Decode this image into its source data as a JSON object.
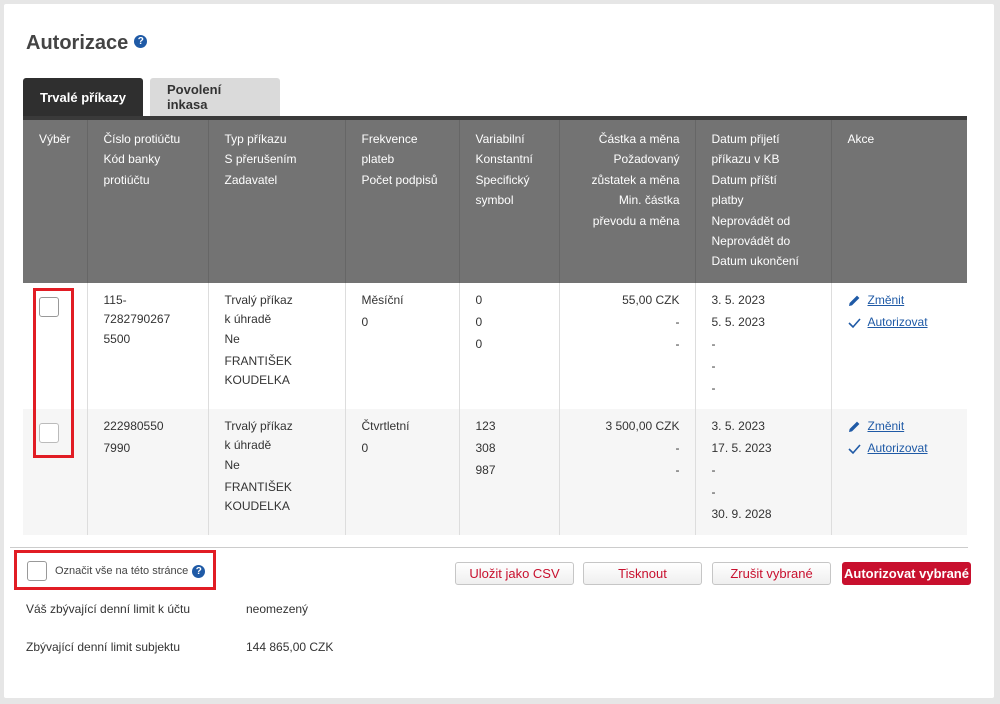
{
  "page": {
    "title": "Autorizace"
  },
  "tabs": [
    {
      "label": "Trvalé příkazy",
      "active": true
    },
    {
      "label": "Povolení inkasa",
      "active": false
    }
  ],
  "table": {
    "headers": [
      [
        "Výběr"
      ],
      [
        "Číslo protiúčtu",
        "Kód banky",
        "protiúčtu"
      ],
      [
        "Typ příkazu",
        "S přerušením",
        "Zadavatel"
      ],
      [
        "Frekvence",
        "plateb",
        "Počet podpisů"
      ],
      [
        "Variabilní",
        "Konstantní",
        "Specifický",
        "symbol"
      ],
      [
        "Částka a měna",
        "Požadovaný",
        "zůstatek a měna",
        "Min. částka",
        "převodu a měna"
      ],
      [
        "Datum přijetí",
        "příkazu v KB",
        "Datum příští",
        "platby",
        "Neprovádět od",
        "Neprovádět do",
        "Datum ukončení"
      ],
      [
        "Akce"
      ]
    ],
    "rows": [
      {
        "account": [
          "115-",
          "7282790267"
        ],
        "bank": "5500",
        "type": [
          "Trvalý příkaz",
          "k úhradě"
        ],
        "interrupt": "Ne",
        "creator": [
          "FRANTIŠEK",
          "KOUDELKA"
        ],
        "freq": "Měsíční",
        "signatures": "0",
        "symbols": [
          "0",
          "0",
          "0"
        ],
        "amounts": [
          "55,00 CZK",
          "-",
          "-"
        ],
        "dates": [
          "3. 5. 2023",
          "5. 5. 2023",
          "-",
          "-",
          "-"
        ],
        "actions": [
          "Změnit",
          "Autorizovat"
        ]
      },
      {
        "account": [
          "222980550"
        ],
        "bank": "7990",
        "type": [
          "Trvalý příkaz",
          "k úhradě"
        ],
        "interrupt": "Ne",
        "creator": [
          "FRANTIŠEK",
          "KOUDELKA"
        ],
        "freq": "Čtvrtletní",
        "signatures": "0",
        "symbols": [
          "123",
          "308",
          "987"
        ],
        "amounts": [
          "3 500,00 CZK",
          "-",
          "-"
        ],
        "dates": [
          "3. 5. 2023",
          "17. 5. 2023",
          "-",
          "-",
          "30. 9. 2028"
        ],
        "actions": [
          "Změnit",
          "Autorizovat"
        ]
      }
    ]
  },
  "select_all": {
    "label": "Označit vše na této stránce"
  },
  "buttons": {
    "csv": "Uložit jako CSV",
    "print": "Tisknout",
    "cancel": "Zrušit vybrané",
    "authorize": "Autorizovat vybrané"
  },
  "limits": [
    {
      "label": "Váš zbývající denní limit k účtu",
      "value": "neomezený"
    },
    {
      "label": "Zbývající denní limit subjektu",
      "value": "144 865,00 CZK"
    }
  ],
  "colors": {
    "accent": "#c8102e",
    "link": "#1f5aa6",
    "header": "#737373",
    "highlight": "#e11c24"
  },
  "icons": {
    "help": "question-circle-icon",
    "edit": "pencil-icon",
    "authorize": "checkmark-icon"
  }
}
